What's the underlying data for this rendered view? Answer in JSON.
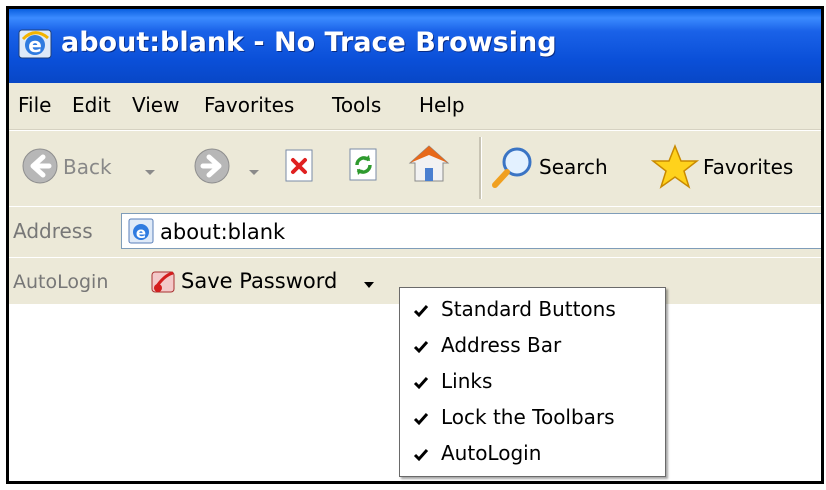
{
  "window": {
    "title": "about:blank - No Trace Browsing"
  },
  "menu": [
    {
      "label": "File"
    },
    {
      "label": "Edit"
    },
    {
      "label": "View"
    },
    {
      "label": "Favorites"
    },
    {
      "label": "Tools"
    },
    {
      "label": "Help"
    }
  ],
  "toolbar": {
    "back_label": "Back",
    "search_label": "Search",
    "favorites_label": "Favorites"
  },
  "address": {
    "label": "Address",
    "value": "about:blank"
  },
  "autologin": {
    "label": "AutoLogin",
    "save_label": "Save Password"
  },
  "context_menu": [
    {
      "label": "Standard Buttons",
      "checked": true
    },
    {
      "label": "Address Bar",
      "checked": true
    },
    {
      "label": "Links",
      "checked": true
    },
    {
      "label": "Lock the Toolbars",
      "checked": true
    },
    {
      "label": "AutoLogin",
      "checked": true
    }
  ],
  "colors": {
    "titlebar": "#0a4fd8",
    "chrome": "#ece9d8",
    "address_border": "#7f9db9"
  },
  "icons": [
    "ie-icon",
    "back-icon",
    "forward-icon",
    "stop-icon",
    "refresh-icon",
    "home-icon",
    "search-icon",
    "favorites-star-icon",
    "autologin-icon",
    "check-icon"
  ]
}
